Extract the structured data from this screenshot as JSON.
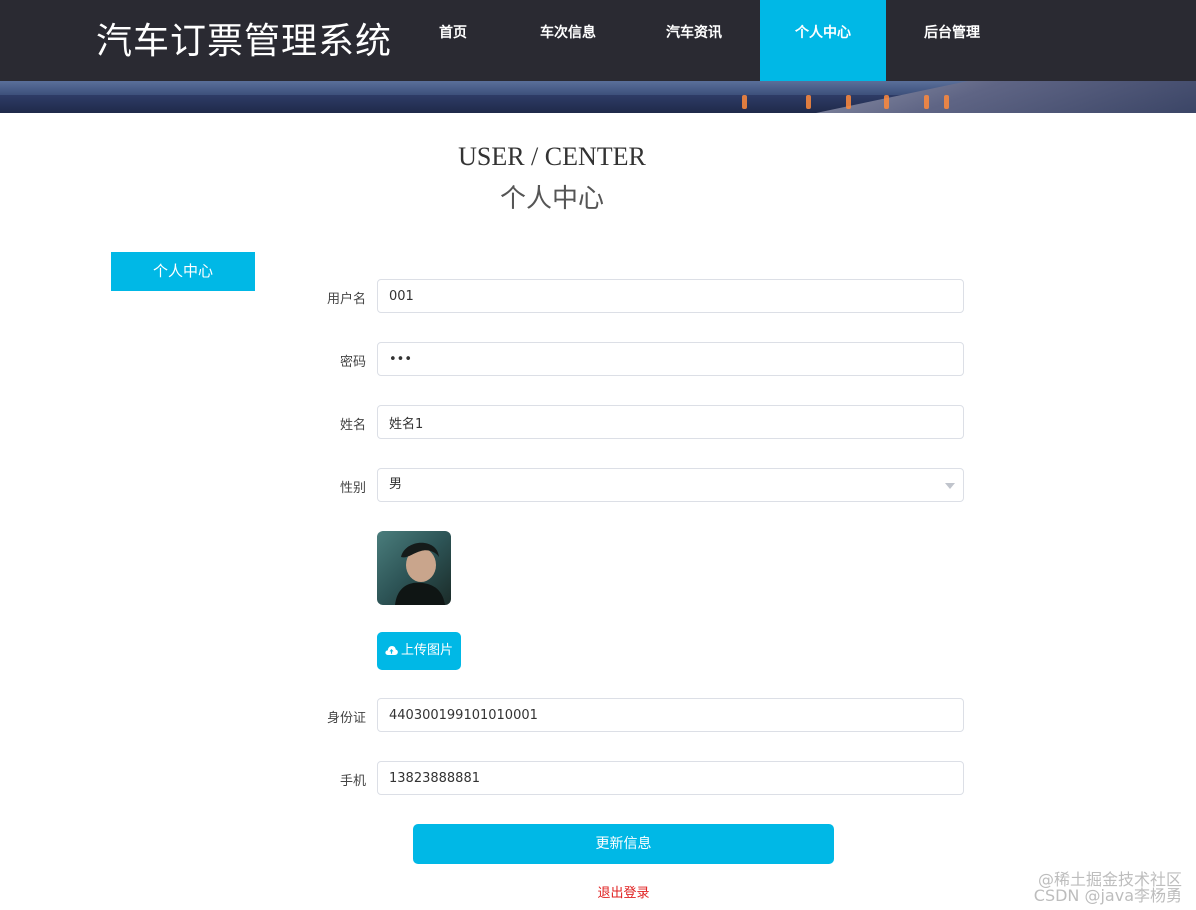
{
  "site": {
    "title": "汽车订票管理系统"
  },
  "nav": {
    "items": [
      {
        "label": "首页"
      },
      {
        "label": "车次信息"
      },
      {
        "label": "汽车资讯"
      },
      {
        "label": "个人中心"
      },
      {
        "label": "后台管理"
      }
    ],
    "active_index": 3
  },
  "heading": {
    "en": "USER / CENTER",
    "cn": "个人中心"
  },
  "sidebar": {
    "tab_label": "个人中心"
  },
  "form": {
    "username": {
      "label": "用户名",
      "value": "001"
    },
    "password": {
      "label": "密码",
      "value": "001"
    },
    "name": {
      "label": "姓名",
      "value": "姓名1"
    },
    "gender": {
      "label": "性别",
      "value": "男"
    },
    "upload_label": "上传图片",
    "id_card": {
      "label": "身份证",
      "value": "440300199101010001"
    },
    "phone": {
      "label": "手机",
      "value": "13823888881"
    }
  },
  "actions": {
    "update_label": "更新信息",
    "logout_label": "退出登录"
  },
  "watermarks": {
    "line1": "@稀土掘金技术社区",
    "line2": "CSDN @java李杨勇"
  },
  "colors": {
    "accent": "#00b8e6",
    "header_bg": "#2a2a32",
    "logout": "#e02020"
  }
}
